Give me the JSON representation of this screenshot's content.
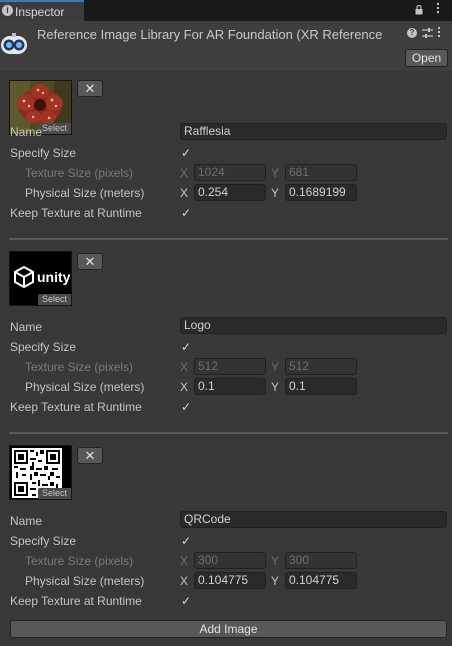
{
  "tab": {
    "label": "Inspector",
    "info_icon": "i"
  },
  "header": {
    "title": "Reference Image Library For AR Foundation (XR Reference",
    "open_label": "Open",
    "help_icon": "?"
  },
  "labels": {
    "name": "Name",
    "specify_size": "Specify Size",
    "texture_size": "Texture Size (pixels)",
    "physical_size": "Physical Size (meters)",
    "keep_texture": "Keep Texture at Runtime",
    "x": "X",
    "y": "Y",
    "select": "Select",
    "remove": "✕",
    "check": "✓"
  },
  "images": [
    {
      "name": "Rafflesia",
      "specify_size": true,
      "texture_x": "1024",
      "texture_y": "681",
      "physical_x": "0.254",
      "physical_y": "0.1689199",
      "keep_texture": true,
      "thumbnail": "rafflesia-flower"
    },
    {
      "name": "Logo",
      "specify_size": true,
      "texture_x": "512",
      "texture_y": "512",
      "physical_x": "0.1",
      "physical_y": "0.1",
      "keep_texture": true,
      "thumbnail": "unity-logo",
      "logo_text": "unity"
    },
    {
      "name": "QRCode",
      "specify_size": true,
      "texture_x": "300",
      "texture_y": "300",
      "physical_x": "0.104775",
      "physical_y": "0.104775",
      "keep_texture": true,
      "thumbnail": "qr-code"
    }
  ],
  "add_label": "Add Image",
  "colors": {
    "tab_accent": "#3a79bb",
    "background": "#383838",
    "field": "#2a2a2a"
  }
}
